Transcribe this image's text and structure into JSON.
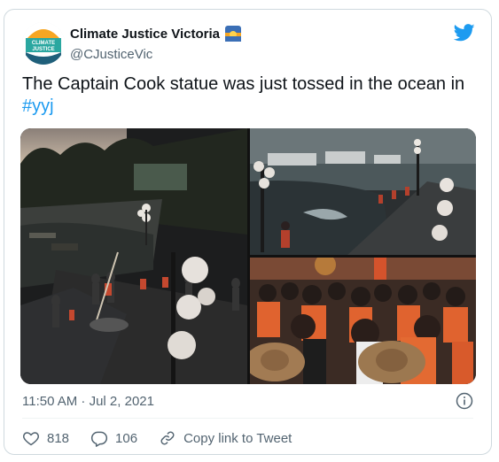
{
  "tweet": {
    "author_name": "Climate Justice Victoria",
    "author_handle": "@CJusticeVic",
    "avatar_text_line1": "CLIMATE",
    "avatar_text_line2": "JUSTICE",
    "body_text": "The Captain Cook statue was just tossed in the ocean in ",
    "hashtag": "#yyj",
    "timestamp": "11:50 AM · Jul 2, 2021",
    "likes": "818",
    "replies": "106",
    "copy_link_label": "Copy link to Tweet"
  },
  "icons": {
    "name_badge": "sunrise-emoji-icon",
    "brand": "twitter-bird-icon",
    "info": "info-icon",
    "like": "heart-icon",
    "reply": "reply-icon",
    "copy_link": "link-icon"
  },
  "colors": {
    "accent": "#1d9bf0",
    "secondary_text": "#536471",
    "border": "#cfd9de"
  }
}
